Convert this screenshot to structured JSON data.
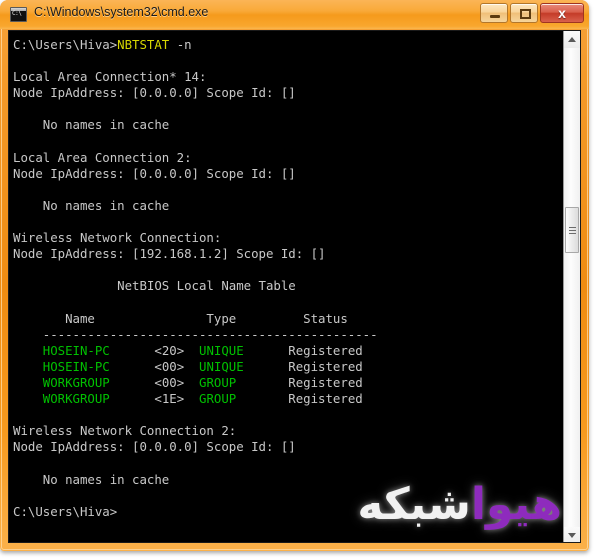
{
  "window": {
    "title": "C:\\Windows\\system32\\cmd.exe",
    "icon": "cmd-console-icon",
    "icon_glyph": "C:\\",
    "frame_color": "#ef8c12",
    "titlebar_color": "#f59a1c"
  },
  "caption_buttons": {
    "minimize_label": "–",
    "maximize_label": "□",
    "close_label": "x"
  },
  "console": {
    "background": "#000000",
    "foreground": "#c8c8c8",
    "colors": {
      "white": "#c8c8c8",
      "yellow": "#d8d800",
      "green": "#00c000"
    },
    "lines": [
      {
        "id": "prompt-command",
        "segments": [
          {
            "text": "C:\\Users\\Hiva>",
            "color": "white"
          },
          {
            "text": "NBTSTAT",
            "color": "yellow"
          },
          {
            "text": " -n",
            "color": "white"
          }
        ]
      },
      {
        "id": "blank-1",
        "segments": [
          {
            "text": "",
            "color": "white"
          }
        ]
      },
      {
        "id": "adapter-1-name",
        "segments": [
          {
            "text": "Local Area Connection* 14:",
            "color": "white"
          }
        ]
      },
      {
        "id": "adapter-1-node",
        "segments": [
          {
            "text": "Node IpAddress: [0.0.0.0] Scope Id: []",
            "color": "white"
          }
        ]
      },
      {
        "id": "blank-2",
        "segments": [
          {
            "text": "",
            "color": "white"
          }
        ]
      },
      {
        "id": "adapter-1-result",
        "segments": [
          {
            "text": "    No names in cache",
            "color": "white"
          }
        ]
      },
      {
        "id": "blank-3",
        "segments": [
          {
            "text": "",
            "color": "white"
          }
        ]
      },
      {
        "id": "adapter-2-name",
        "segments": [
          {
            "text": "Local Area Connection 2:",
            "color": "white"
          }
        ]
      },
      {
        "id": "adapter-2-node",
        "segments": [
          {
            "text": "Node IpAddress: [0.0.0.0] Scope Id: []",
            "color": "white"
          }
        ]
      },
      {
        "id": "blank-4",
        "segments": [
          {
            "text": "",
            "color": "white"
          }
        ]
      },
      {
        "id": "adapter-2-result",
        "segments": [
          {
            "text": "    No names in cache",
            "color": "white"
          }
        ]
      },
      {
        "id": "blank-5",
        "segments": [
          {
            "text": "",
            "color": "white"
          }
        ]
      },
      {
        "id": "adapter-3-name",
        "segments": [
          {
            "text": "Wireless Network Connection:",
            "color": "white"
          }
        ]
      },
      {
        "id": "adapter-3-node",
        "segments": [
          {
            "text": "Node IpAddress: [192.168.1.2] Scope Id: []",
            "color": "white"
          }
        ]
      },
      {
        "id": "blank-6",
        "segments": [
          {
            "text": "",
            "color": "white"
          }
        ]
      },
      {
        "id": "table-title",
        "segments": [
          {
            "text": "              NetBIOS Local Name Table",
            "color": "white"
          }
        ]
      },
      {
        "id": "blank-7",
        "segments": [
          {
            "text": "",
            "color": "white"
          }
        ]
      },
      {
        "id": "table-header",
        "segments": [
          {
            "text": "       Name               Type         Status",
            "color": "white"
          }
        ]
      },
      {
        "id": "table-rule",
        "segments": [
          {
            "text": "    ---------------------------------------------",
            "color": "white"
          }
        ]
      },
      {
        "id": "table-row-1",
        "segments": [
          {
            "text": "    ",
            "color": "white"
          },
          {
            "text": "HOSEIN-PC",
            "color": "green"
          },
          {
            "text": "      <20>  ",
            "color": "white"
          },
          {
            "text": "UNIQUE",
            "color": "green"
          },
          {
            "text": "      Registered",
            "color": "white"
          }
        ]
      },
      {
        "id": "table-row-2",
        "segments": [
          {
            "text": "    ",
            "color": "white"
          },
          {
            "text": "HOSEIN-PC",
            "color": "green"
          },
          {
            "text": "      <00>  ",
            "color": "white"
          },
          {
            "text": "UNIQUE",
            "color": "green"
          },
          {
            "text": "      Registered",
            "color": "white"
          }
        ]
      },
      {
        "id": "table-row-3",
        "segments": [
          {
            "text": "    ",
            "color": "white"
          },
          {
            "text": "WORKGROUP",
            "color": "green"
          },
          {
            "text": "      <00>  ",
            "color": "white"
          },
          {
            "text": "GROUP",
            "color": "green"
          },
          {
            "text": "       Registered",
            "color": "white"
          }
        ]
      },
      {
        "id": "table-row-4",
        "segments": [
          {
            "text": "    ",
            "color": "white"
          },
          {
            "text": "WORKGROUP",
            "color": "green"
          },
          {
            "text": "      <1E>  ",
            "color": "white"
          },
          {
            "text": "GROUP",
            "color": "green"
          },
          {
            "text": "       Registered",
            "color": "white"
          }
        ]
      },
      {
        "id": "blank-8",
        "segments": [
          {
            "text": "",
            "color": "white"
          }
        ]
      },
      {
        "id": "adapter-4-name",
        "segments": [
          {
            "text": "Wireless Network Connection 2:",
            "color": "white"
          }
        ]
      },
      {
        "id": "adapter-4-node",
        "segments": [
          {
            "text": "Node IpAddress: [0.0.0.0] Scope Id: []",
            "color": "white"
          }
        ]
      },
      {
        "id": "blank-9",
        "segments": [
          {
            "text": "",
            "color": "white"
          }
        ]
      },
      {
        "id": "adapter-4-result",
        "segments": [
          {
            "text": "    No names in cache",
            "color": "white"
          }
        ]
      },
      {
        "id": "blank-10",
        "segments": [
          {
            "text": "",
            "color": "white"
          }
        ]
      },
      {
        "id": "prompt-trailing",
        "segments": [
          {
            "text": "C:\\Users\\Hiva>",
            "color": "white"
          }
        ]
      }
    ]
  },
  "watermark": {
    "white_text": "شبکه",
    "purple_text": "هیوا",
    "white_color": "#f2f2f2",
    "purple_color": "#8e2bbd"
  },
  "scrollbar": {
    "up_arrow": "scroll-up-arrow",
    "down_arrow": "scroll-down-arrow",
    "thumb": "scroll-thumb"
  }
}
